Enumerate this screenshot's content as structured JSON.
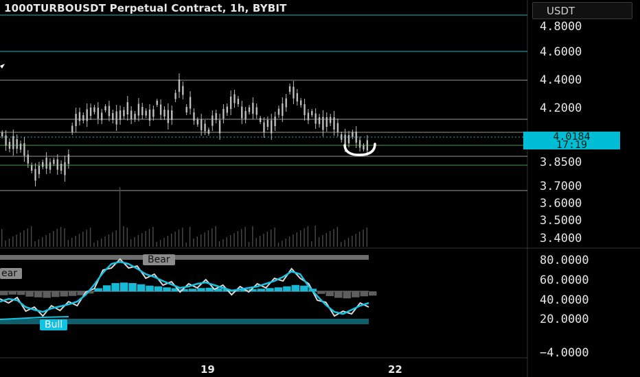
{
  "title": "1000TURBOUSDT Perpetual Contract, 1h, BYBIT",
  "currency": "USDT",
  "colors": {
    "background": "#000000",
    "candle": "#bdbdbd",
    "hline_cyan": "#21b1c4",
    "hline_green": "#43a047",
    "accent": "#00bcd4"
  },
  "price_axis": {
    "labels": [
      "4.8000",
      "4.6000",
      "4.4000",
      "4.2000",
      "3.8500",
      "3.7000",
      "3.6000",
      "3.5000",
      "3.4000"
    ]
  },
  "current_price": {
    "value": "4.0184",
    "countdown": "17:19"
  },
  "oscillator_axis": {
    "labels": [
      "80.0000",
      "60.0000",
      "40.0000",
      "20.0000",
      "−4.0000"
    ]
  },
  "time_axis": {
    "labels": [
      "19",
      "22"
    ]
  },
  "oscillator_tags": {
    "bear": "Bear",
    "bear_partial": "ear",
    "bull": "Bull"
  },
  "drawing": {
    "annotation": "U-shape marker",
    "cursor_glyph": "arrow-cursor-icon"
  }
}
